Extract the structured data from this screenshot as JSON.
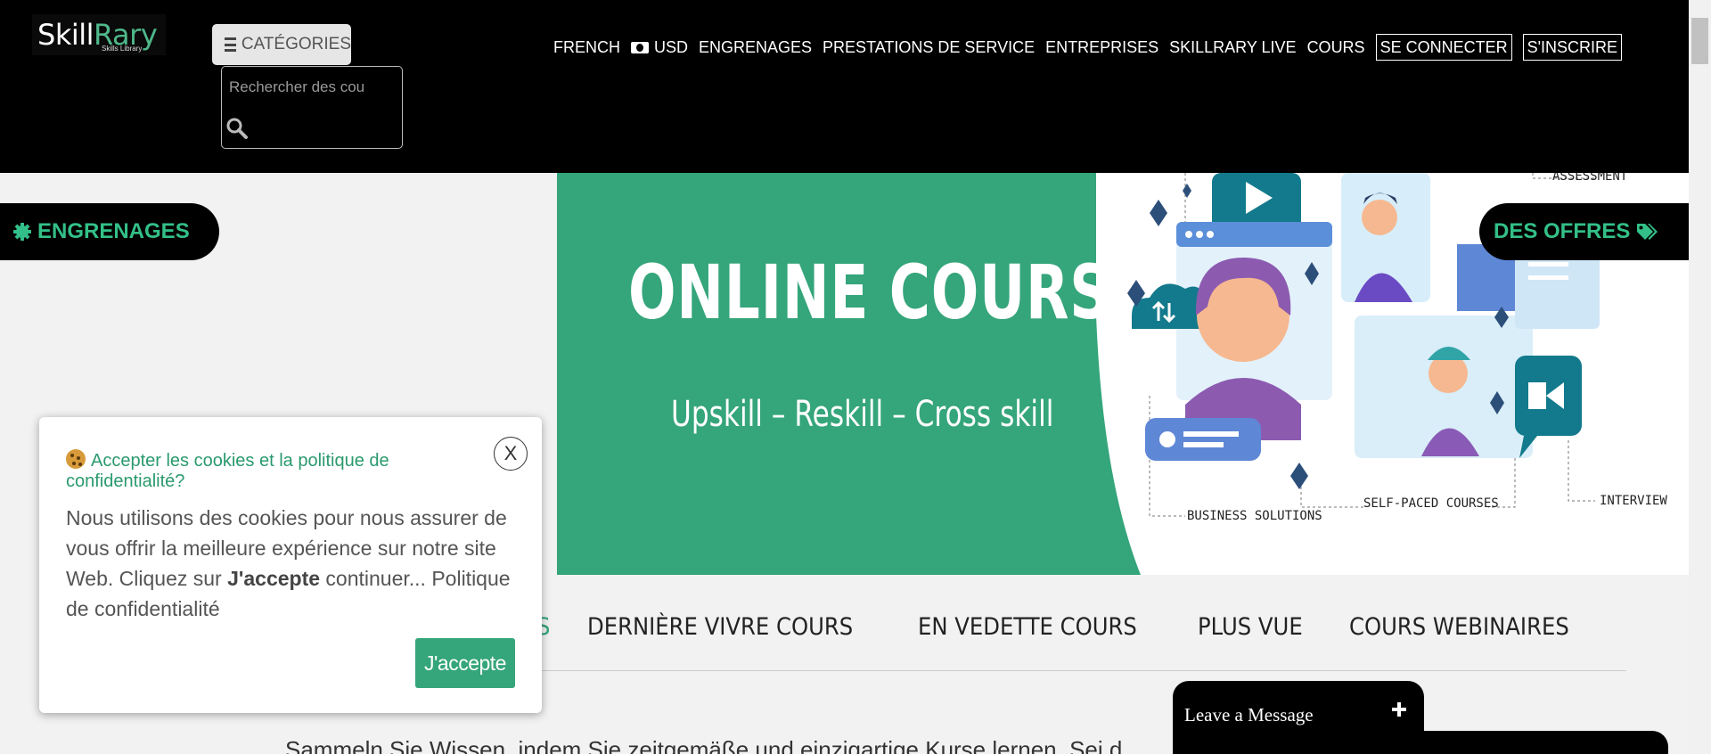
{
  "brand": {
    "name_a": "Skill",
    "name_b": "Rary",
    "tagline": "Skills Library"
  },
  "header": {
    "categories_label": "CATÉGORIES",
    "search_placeholder": "Rechercher des cou",
    "nav": [
      {
        "label": "FRENCH"
      },
      {
        "label": "USD",
        "icon": "cash-icon"
      },
      {
        "label": "ENGRENAGES"
      },
      {
        "label": "PRESTATIONS DE SERVICE"
      },
      {
        "label": "ENTREPRISES"
      },
      {
        "label": "SKILLRARY LIVE"
      },
      {
        "label": "COURS"
      }
    ],
    "login_label": "SE CONNECTER",
    "signup_label": "S'INSCRIRE"
  },
  "banner": {
    "title": "ONLINE COURSES",
    "subtitle": "Upskill – Reskill – Cross skill",
    "labels": {
      "assessment": "ASSESSMENT",
      "business": "BUSINESS SOLUTIONS",
      "self_paced": "SELF-PACED COURSES",
      "interview": "INTERVIEW"
    },
    "accent_color": "#35a57b"
  },
  "side_tabs": {
    "left_label": "ENGRENAGES",
    "left_icon": "gear-icon",
    "right_label": "DES OFFRES",
    "right_icon": "tags-icon"
  },
  "course_tabs": [
    {
      "label": "S",
      "active": true
    },
    {
      "label": "DERNIÈRE VIVRE COURS",
      "active": false
    },
    {
      "label": "EN VEDETTE COURS",
      "active": false
    },
    {
      "label": "PLUS VUE",
      "active": false
    },
    {
      "label": "COURS WEBINAIRES",
      "active": false
    }
  ],
  "intro_text": "Sammeln Sie Wissen, indem Sie zeitgemäße und einzigartige Kurse lernen. Sei d",
  "cookie": {
    "title": "Accepter les cookies et la politique de confidentialité?",
    "body_prefix": "Nous utilisons des cookies pour nous assurer de vous offrir la meilleure expérience sur notre site Web. Cliquez sur ",
    "body_bold": "J'accepte",
    "body_suffix": " continuer... Politique de confidentialité",
    "close_label": "X",
    "accept_label": "J'accepte"
  },
  "message_widget": {
    "label": "Leave a Message"
  }
}
